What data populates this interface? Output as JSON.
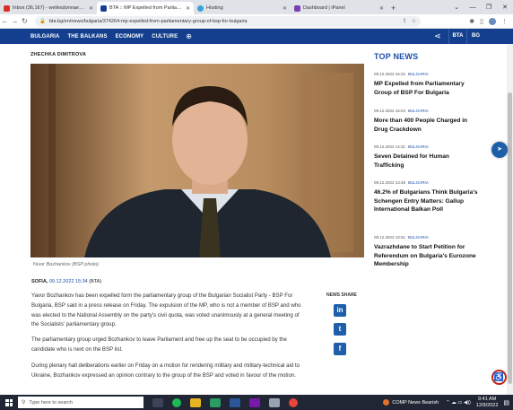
{
  "browser": {
    "tabs": [
      {
        "title": "Inbox (36,167) - wellesdonnae@...",
        "favicon_color": "#d93025",
        "active": false
      },
      {
        "title": "BTA :: MP Expelled from Parliame...",
        "favicon_color": "#143f8f",
        "active": true
      },
      {
        "title": "Hosting",
        "favicon_color": "#3aa0d8",
        "active": false
      },
      {
        "title": "Dashboard | iPanel",
        "favicon_color": "#7a3fb0",
        "active": false
      }
    ],
    "url": "bta.bg/en/news/bulgaria/374264-mp-expelled-from-parliamentary-group-of-bsp-for-bulgaria"
  },
  "nav": {
    "items": [
      "BULGARIA",
      "THE BALKANS",
      "ECONOMY",
      "CULTURE"
    ],
    "langs": [
      "BTA",
      "BG"
    ]
  },
  "article": {
    "author": "ZHECHKA DIMITROVA",
    "caption": "Yavor Bozhankov (BSP photo)",
    "place": "SOFIA,",
    "date": "09.12.2022 15:34",
    "source": "(BTA)",
    "paragraphs": [
      "Yavor Bozhankov has been expelled form the parliamentary group of the Bulgarian Socialist Party - BSP For Bulgaria, BSP said in a press release on Friday. The expulsion of the MP, who is not a member of BSP and who was elected to the National Assembly on the party's civil quota, was voted unanimously at a general meeting of the Socialists' parliamentary group.",
      "The parliamentary group urged Bozhankov to leave Parliament and free up the seat to be occupied by the candidate who is next on the BSP list.",
      "During plenary hall deliberations earlier on Friday on a motion for rendering military and military-technical aid to Ukraine, Bozhankov expressed an opinion contrary to the group of the BSP and voted in favour of the motion."
    ],
    "share_label": "NEWS SHARE"
  },
  "sidebar": {
    "title": "TOP NEWS",
    "items": [
      {
        "time": "09.12.2022 15:34",
        "category": "BULGARIA",
        "headline": "MP Expelled from Parliamentary Group of BSP For Bulgaria"
      },
      {
        "time": "09.12.2022 15:04",
        "category": "BULGARIA",
        "headline": "More than 400 People Charged in Drug Crackdown"
      },
      {
        "time": "09.12.2022 14:31",
        "category": "BULGARIA",
        "headline": "Seven Detained for Human Trafficking"
      },
      {
        "time": "09.12.2022 13:48",
        "category": "BULGARIA",
        "headline": "46.2% of Bulgarians Think Bulgaria's Schengen Entry Matters: Gallup International Balkan Poll"
      },
      {
        "time": "09.12.2022 13:51",
        "category": "BULGARIA",
        "headline": "Vazrazhdane to Start Petition for Referendum on Bulgaria's Eurozone Membership"
      }
    ]
  },
  "taskbar": {
    "search_placeholder": "Type here to search",
    "weather": "COMP  News Bearish",
    "time": "9:41 AM",
    "date": "12/9/2022"
  }
}
